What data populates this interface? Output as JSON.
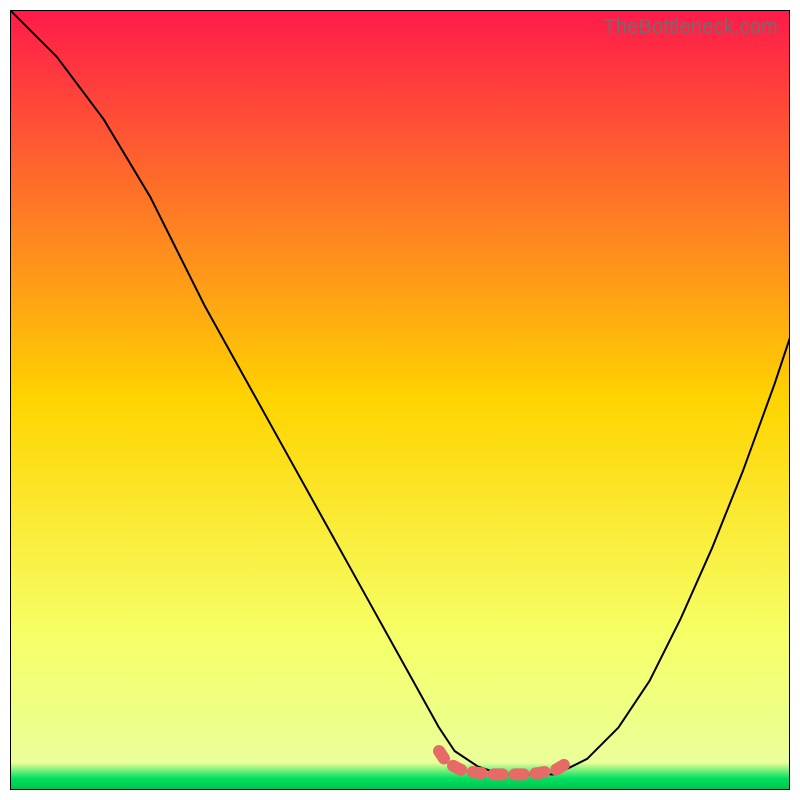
{
  "watermark": "TheBottleneck.com",
  "chart_data": {
    "type": "line",
    "title": "",
    "xlabel": "",
    "ylabel": "",
    "xlim": [
      0,
      100
    ],
    "ylim": [
      0,
      100
    ],
    "grid": false,
    "legend": false,
    "background_gradient": {
      "stops": [
        {
          "offset": 0.0,
          "color": "#ff1a4b"
        },
        {
          "offset": 0.5,
          "color": "#ffd400"
        },
        {
          "offset": 0.8,
          "color": "#f6ff66"
        },
        {
          "offset": 0.965,
          "color": "#eaff99"
        },
        {
          "offset": 0.985,
          "color": "#00e060"
        },
        {
          "offset": 1.0,
          "color": "#00c050"
        }
      ]
    },
    "series": [
      {
        "name": "bottleneck-curve",
        "color": "#000000",
        "x": [
          0,
          3,
          6,
          9,
          12,
          15,
          18,
          21,
          25,
          30,
          35,
          40,
          45,
          50,
          55,
          57,
          60,
          63,
          66,
          70,
          74,
          78,
          82,
          86,
          90,
          94,
          98,
          100
        ],
        "y": [
          100,
          97,
          94,
          90,
          86,
          81,
          76,
          70,
          62,
          53,
          44,
          35,
          26,
          17,
          8,
          5,
          3,
          2,
          2,
          2,
          4,
          8,
          14,
          22,
          31,
          41,
          52,
          58
        ]
      },
      {
        "name": "optimal-range-marker",
        "color": "#e66a66",
        "x": [
          55,
          56,
          58,
          60,
          62,
          64,
          66,
          68,
          70,
          71,
          72
        ],
        "y": [
          5,
          3.5,
          2.5,
          2.2,
          2.0,
          2.0,
          2.0,
          2.2,
          2.6,
          3.2,
          4.2
        ]
      }
    ]
  }
}
